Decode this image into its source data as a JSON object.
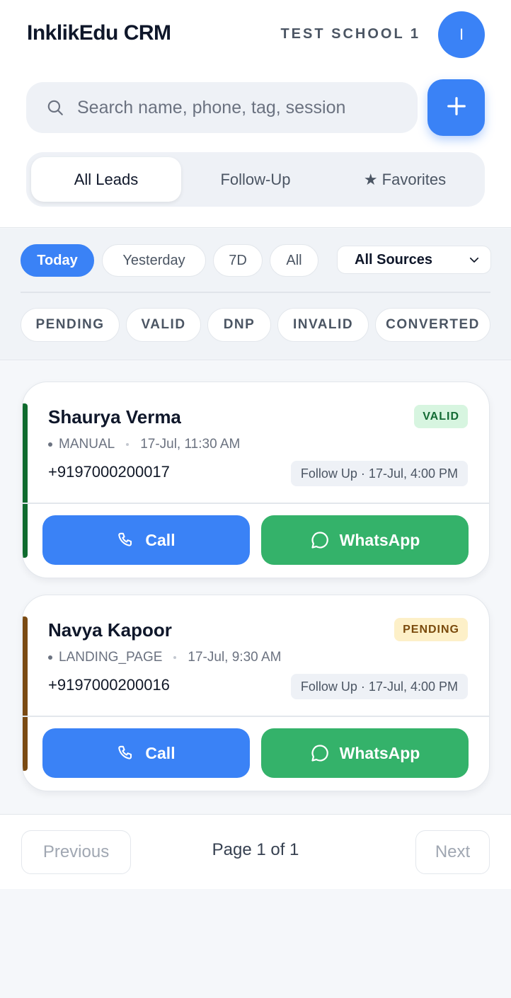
{
  "header": {
    "brand": "InklikEdu CRM",
    "school": "TEST SCHOOL 1",
    "avatar_initial": "I"
  },
  "search": {
    "placeholder": "Search name, phone, tag, session",
    "value": ""
  },
  "tabs": [
    {
      "label": "All Leads",
      "active": true
    },
    {
      "label": "Follow-Up",
      "active": false
    },
    {
      "label": "★ Favorites",
      "active": false
    }
  ],
  "date_filters": [
    {
      "label": "Today",
      "active": true
    },
    {
      "label": "Yesterday",
      "active": false
    },
    {
      "label": "7D",
      "active": false
    },
    {
      "label": "All",
      "active": false
    }
  ],
  "source_select": {
    "selected": "All Sources"
  },
  "status_filters": [
    "PENDING",
    "VALID",
    "DNP",
    "INVALID",
    "CONVERTED"
  ],
  "leads": [
    {
      "name": "Shaurya Verma",
      "status": "VALID",
      "source": "MANUAL",
      "created": "17-Jul, 11:30 AM",
      "phone": "+9197000200017",
      "followup": "Follow Up · 17-Jul, 4:00 PM",
      "call_label": "Call",
      "whatsapp_label": "WhatsApp"
    },
    {
      "name": "Navya Kapoor",
      "status": "PENDING",
      "source": "LANDING_PAGE",
      "created": "17-Jul, 9:30 AM",
      "phone": "+9197000200016",
      "followup": "Follow Up · 17-Jul, 4:00 PM",
      "call_label": "Call",
      "whatsapp_label": "WhatsApp"
    }
  ],
  "pagination": {
    "previous": "Previous",
    "info": "Page 1 of 1",
    "next": "Next"
  },
  "colors": {
    "primary": "#3a82f6",
    "whatsapp": "#34b26a",
    "valid_accent": "#0f6b2e",
    "pending_accent": "#7a4a12",
    "valid_badge_bg": "#d7f5e0",
    "valid_badge_text": "#136b34",
    "pending_badge_bg": "#fdf0c8",
    "pending_badge_text": "#7a4a0c"
  },
  "icons": {
    "search": "search-icon",
    "add": "plus-icon",
    "dropdown": "chevron-down-icon",
    "call": "phone-icon",
    "whatsapp": "whatsapp-icon"
  }
}
